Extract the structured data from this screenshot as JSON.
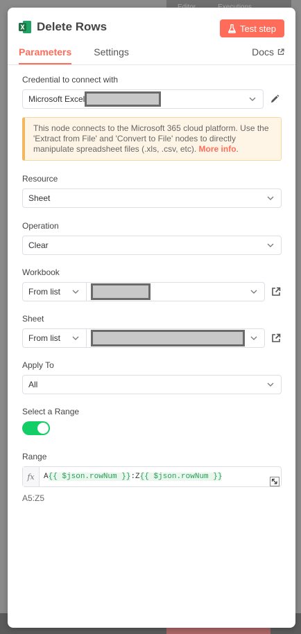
{
  "background": {
    "tab_editor": "Editor",
    "tab_executions": "Executions"
  },
  "header": {
    "title": "Delete Rows",
    "test_step_label": "Test step",
    "tabs": [
      {
        "label": "Parameters"
      },
      {
        "label": "Settings"
      }
    ],
    "docs_label": "Docs"
  },
  "credential": {
    "label": "Credential to connect with",
    "value": "Microsoft Excel"
  },
  "callout": {
    "text": "This node connects to the Microsoft 365 cloud platform. Use the 'Extract from File' and 'Convert to File' nodes to directly manipulate spreadsheet files (.xls, .csv, etc). ",
    "link": "More info"
  },
  "resource": {
    "label": "Resource",
    "value": "Sheet"
  },
  "operation": {
    "label": "Operation",
    "value": "Clear"
  },
  "workbook": {
    "label": "Workbook",
    "mode": "From list"
  },
  "sheet": {
    "label": "Sheet",
    "mode": "From list"
  },
  "apply_to": {
    "label": "Apply To",
    "value": "All"
  },
  "select_range": {
    "label": "Select a Range",
    "enabled": true
  },
  "range": {
    "label": "Range",
    "fx": "fx",
    "prefix": "A",
    "expr1": "{{ $json.rowNum }}",
    "middle": ":Z",
    "expr2": "{{ $json.rowNum }}",
    "preview": "A5:Z5"
  },
  "colors": {
    "accent": "#ff6d5a",
    "toggle_on": "#13ce66",
    "excel_green": "#1f7244"
  }
}
